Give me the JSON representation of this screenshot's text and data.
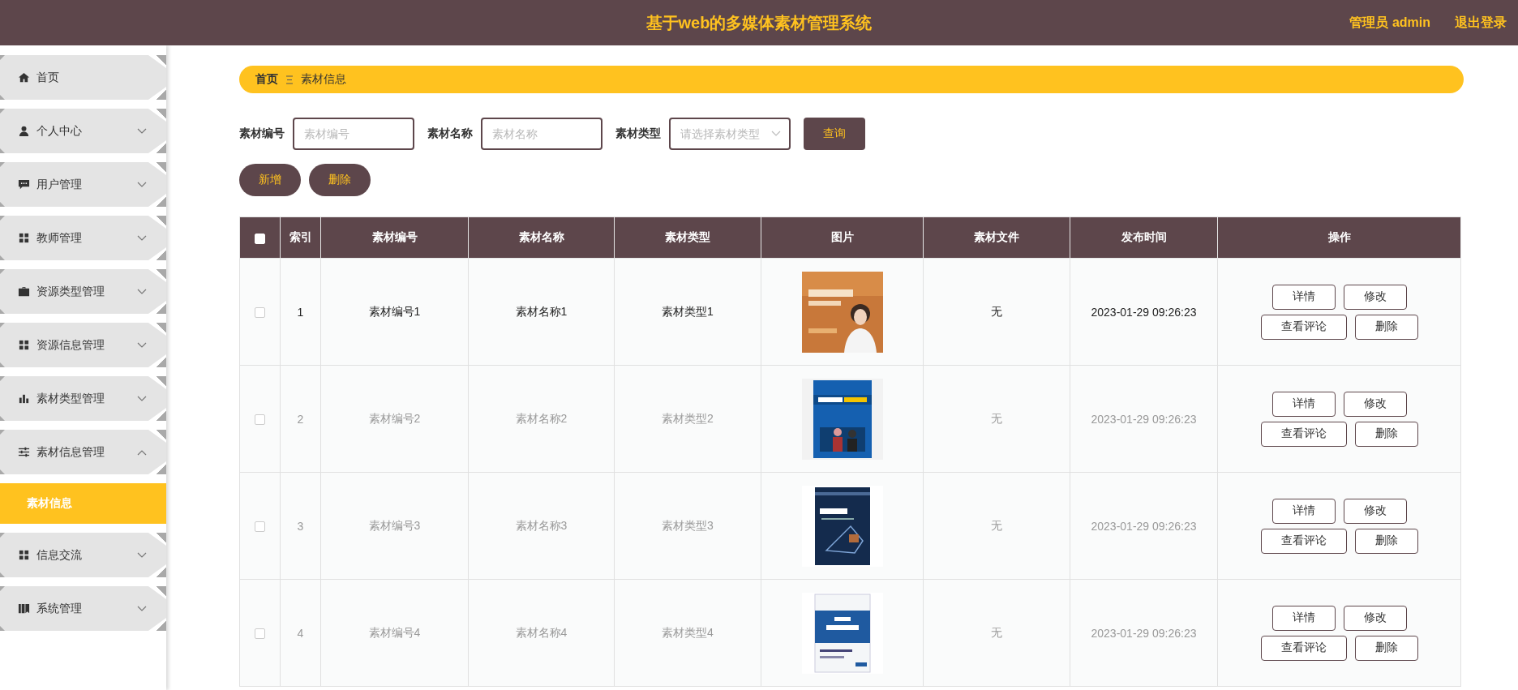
{
  "header": {
    "title": "基于web的多媒体素材管理系统",
    "user": "管理员 admin",
    "logout": "退出登录"
  },
  "sidebar": {
    "items": [
      {
        "label": "首页",
        "kind": "link"
      },
      {
        "label": "个人中心",
        "kind": "menu",
        "expanded": false
      },
      {
        "label": "用户管理",
        "kind": "menu",
        "expanded": false
      },
      {
        "label": "教师管理",
        "kind": "menu",
        "expanded": false
      },
      {
        "label": "资源类型管理",
        "kind": "menu",
        "expanded": false
      },
      {
        "label": "资源信息管理",
        "kind": "menu",
        "expanded": false
      },
      {
        "label": "素材类型管理",
        "kind": "menu",
        "expanded": false
      },
      {
        "label": "素材信息管理",
        "kind": "menu",
        "expanded": true,
        "children": [
          {
            "label": "素材信息",
            "selected": true
          }
        ]
      },
      {
        "label": "信息交流",
        "kind": "menu",
        "expanded": false
      },
      {
        "label": "系统管理",
        "kind": "menu",
        "expanded": false
      }
    ]
  },
  "breadcrumb": [
    "首页",
    "素材信息"
  ],
  "search": {
    "fields": [
      {
        "label": "素材编号",
        "placeholder": "素材编号",
        "kind": "text"
      },
      {
        "label": "素材名称",
        "placeholder": "素材名称",
        "kind": "text"
      },
      {
        "label": "素材类型",
        "placeholder": "请选择素材类型",
        "kind": "select"
      }
    ],
    "button": "查询"
  },
  "actions": [
    "新增",
    "删除"
  ],
  "table": {
    "select_all": {
      "checked": false
    },
    "columns": [
      "索引",
      "素材编号",
      "素材名称",
      "素材类型",
      "图片",
      "素材文件",
      "发布时间",
      "操作"
    ],
    "rows": [
      {
        "checked": false,
        "hovered": true,
        "index": "1",
        "code": "素材编号1",
        "name": "素材名称1",
        "type": "素材类型1",
        "file": "无",
        "time": "2023-01-29 09:26:23",
        "buttons": [
          "详情",
          "修改",
          "查看评论",
          "删除"
        ]
      },
      {
        "checked": false,
        "hovered": false,
        "index": "2",
        "code": "素材编号2",
        "name": "素材名称2",
        "type": "素材类型2",
        "file": "无",
        "time": "2023-01-29 09:26:23",
        "buttons": [
          "详情",
          "修改",
          "查看评论",
          "删除"
        ]
      },
      {
        "checked": false,
        "hovered": false,
        "index": "3",
        "code": "素材编号3",
        "name": "素材名称3",
        "type": "素材类型3",
        "file": "无",
        "time": "2023-01-29 09:26:23",
        "buttons": [
          "详情",
          "修改",
          "查看评论",
          "删除"
        ]
      },
      {
        "checked": false,
        "hovered": false,
        "index": "4",
        "code": "素材编号4",
        "name": "素材名称4",
        "type": "素材类型4",
        "file": "无",
        "time": "2023-01-29 09:26:23",
        "buttons": [
          "详情",
          "修改",
          "查看评论",
          "删除"
        ]
      }
    ]
  }
}
